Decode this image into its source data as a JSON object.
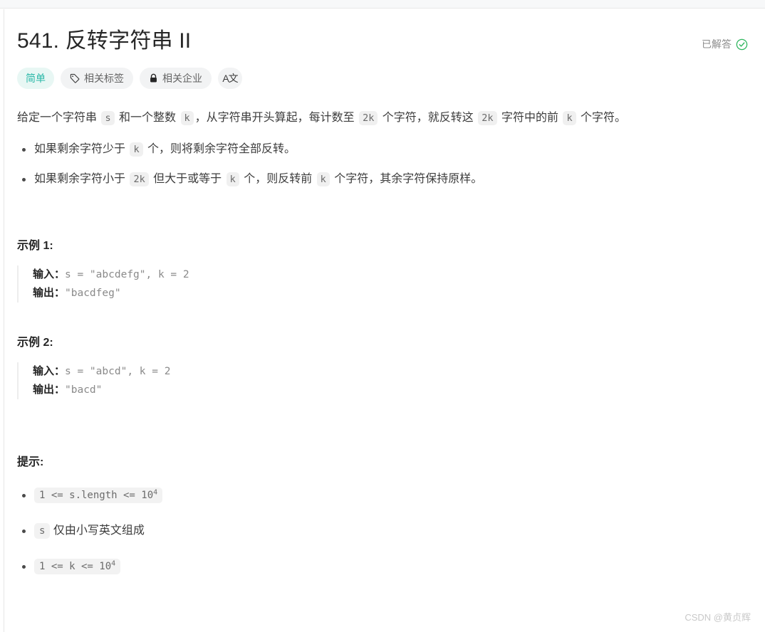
{
  "problem": {
    "title": "541. 反转字符串 II",
    "solved_label": "已解答",
    "solved_icon": "check-circle-icon",
    "accent_color": "#2ab8a8",
    "solved_color": "#2db55d"
  },
  "badges": [
    {
      "label": "简单",
      "icon": null,
      "kind": "difficulty"
    },
    {
      "label": "相关标签",
      "icon": "tag-icon",
      "kind": "normal"
    },
    {
      "label": "相关企业",
      "icon": "lock-icon",
      "kind": "normal"
    },
    {
      "label": "A文",
      "icon": "translate-icon",
      "kind": "icon-only"
    }
  ],
  "description": {
    "intro": {
      "p1": "给定一个字符串 ",
      "c1": "s",
      "p2": " 和一个整数 ",
      "c2": "k",
      "p3": "，从字符串开头算起，每计数至 ",
      "c3": "2k",
      "p4": " 个字符，就反转这 ",
      "c4": "2k",
      "p5": " 字符中的前 ",
      "c5": "k",
      "p6": " 个字符。"
    },
    "rules": [
      {
        "p1": "如果剩余字符少于 ",
        "c1": "k",
        "p2": " 个，则将剩余字符全部反转。",
        "c2": "",
        "p3": "",
        "c3": "",
        "p4": ""
      },
      {
        "p1": "如果剩余字符小于 ",
        "c1": "2k",
        "p2": " 但大于或等于 ",
        "c2": "k",
        "p3": " 个，则反转前 ",
        "c3": "k",
        "p4": " 个字符，其余字符保持原样。"
      }
    ]
  },
  "examples": [
    {
      "title": "示例 1:",
      "input_label": "输入：",
      "input_value": "s = \"abcdefg\", k = 2",
      "output_label": "输出：",
      "output_value": "\"bacdfeg\""
    },
    {
      "title": "示例 2:",
      "input_label": "输入：",
      "input_value": "s = \"abcd\", k = 2",
      "output_label": "输出：",
      "output_value": "\"bacd\""
    }
  ],
  "hints": {
    "title": "提示:",
    "items": [
      {
        "code_pre": "1 <= s.length <= 10",
        "code_sup": "4",
        "text_after": "",
        "text_before": ""
      },
      {
        "code_pre": "s",
        "code_sup": "",
        "text_after": " 仅由小写英文组成",
        "text_before": ""
      },
      {
        "code_pre": "1 <= k <= 10",
        "code_sup": "4",
        "text_after": "",
        "text_before": ""
      }
    ]
  },
  "watermark": {
    "text": "CSDN @黄贞辉"
  }
}
